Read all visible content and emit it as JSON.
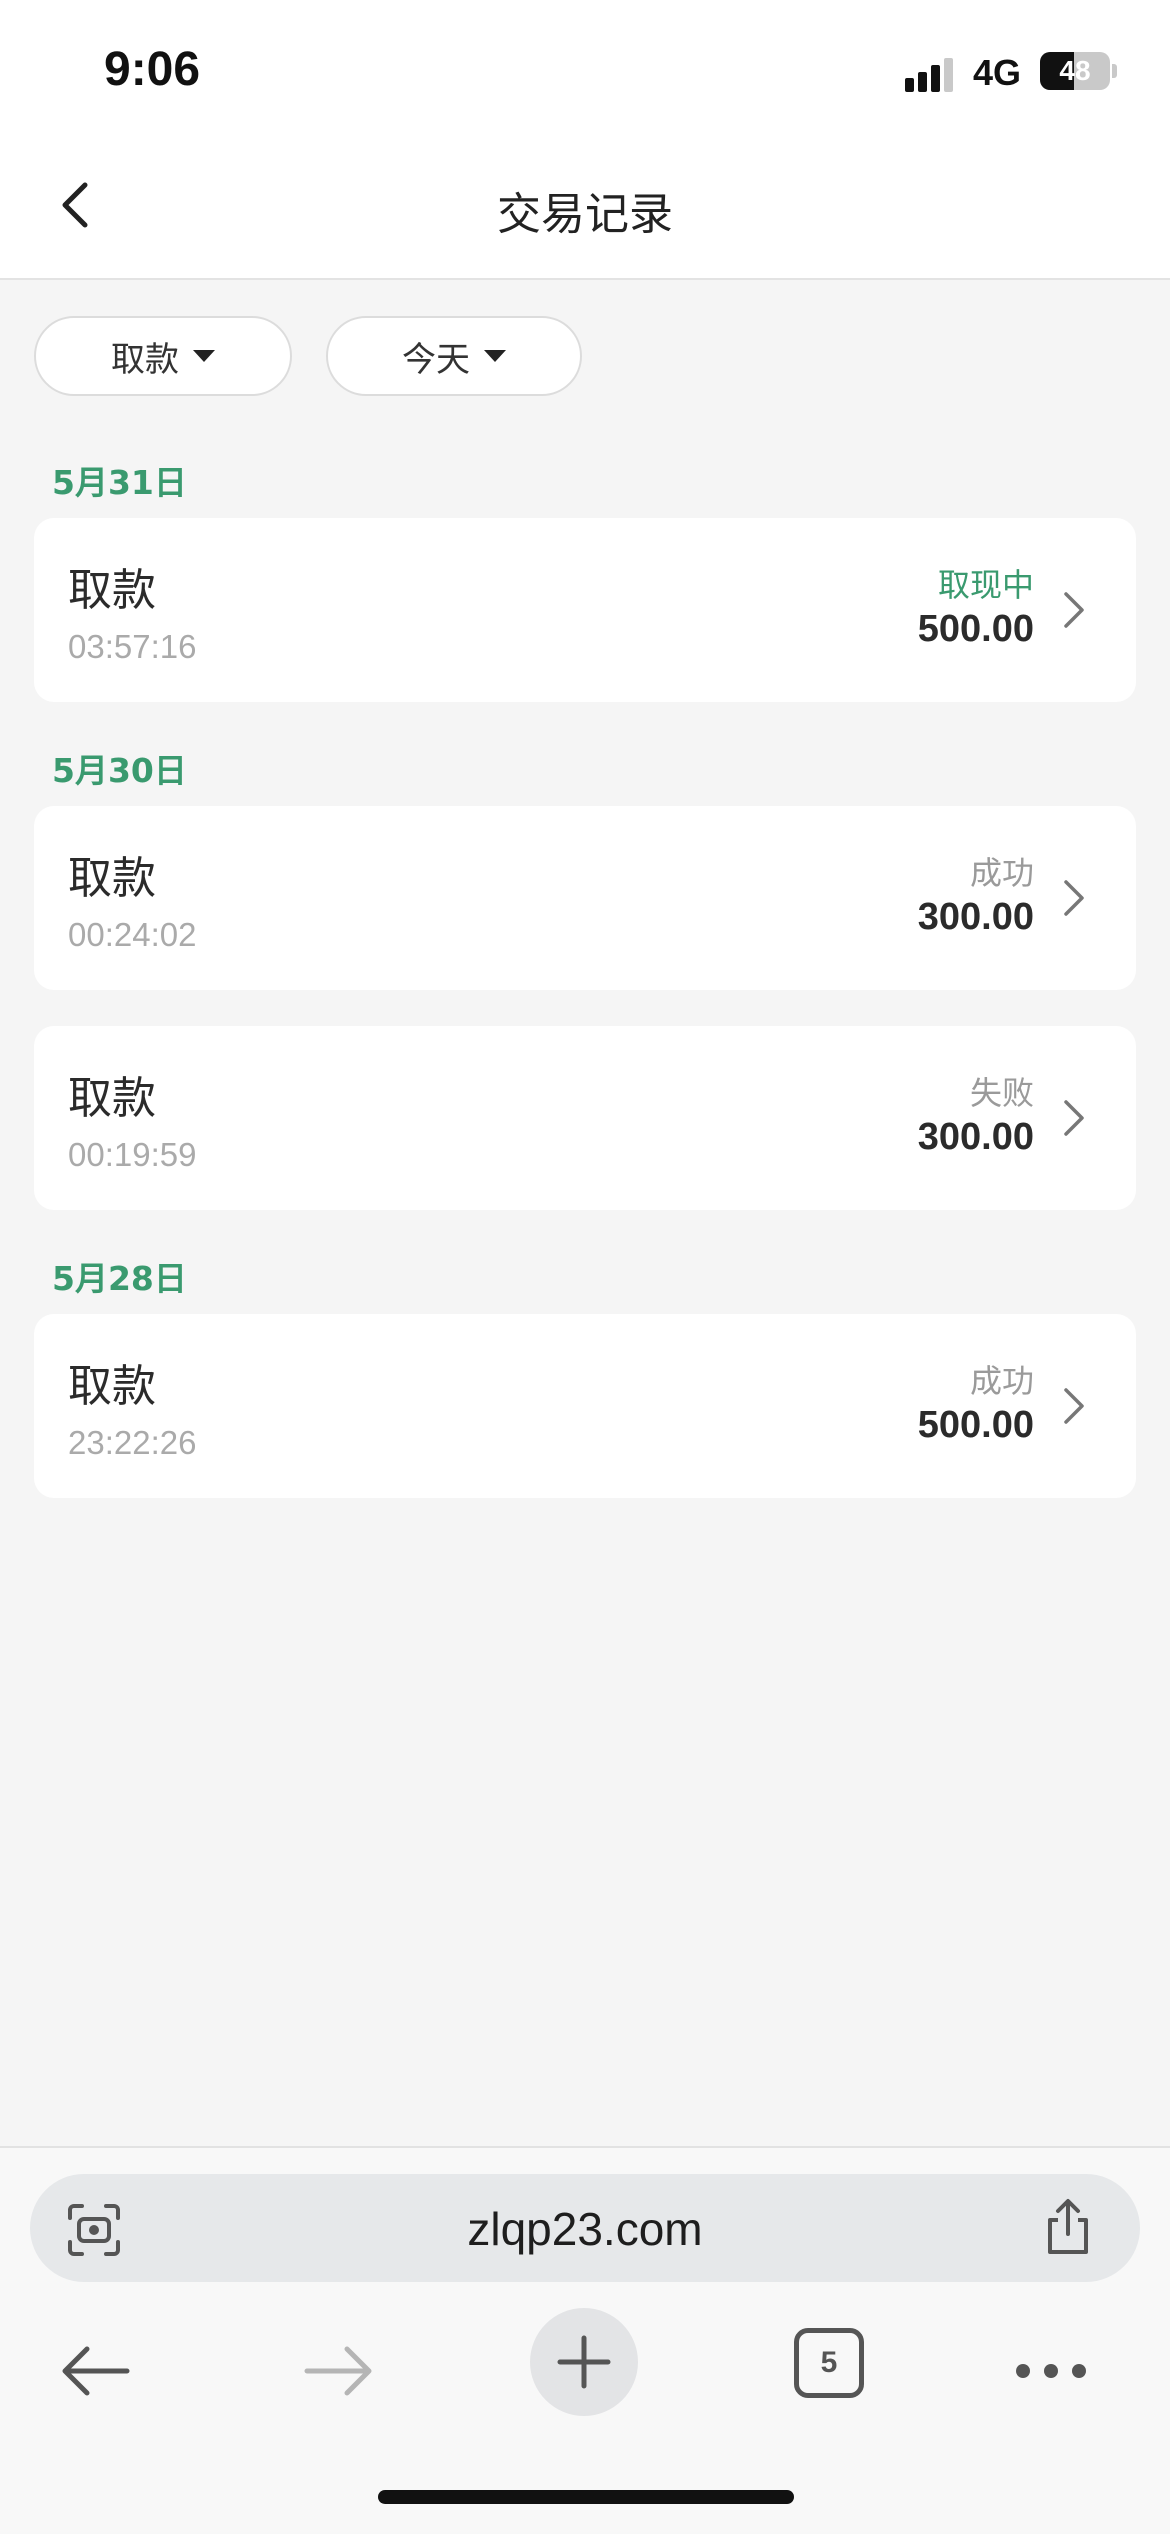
{
  "status_bar": {
    "time": "9:06",
    "network": "4G",
    "battery": "48",
    "battery_level": 0.48
  },
  "header": {
    "title": "交易记录",
    "back_icon": "chevron-left-icon"
  },
  "filters": [
    {
      "label": "取款"
    },
    {
      "label": "今天"
    }
  ],
  "groups": [
    {
      "date": "5月31日",
      "records": [
        {
          "type": "取款",
          "time": "03:57:16",
          "status": "取现中",
          "amount": "500.00",
          "status_kind": "pending"
        }
      ]
    },
    {
      "date": "5月30日",
      "records": [
        {
          "type": "取款",
          "time": "00:24:02",
          "status": "成功",
          "amount": "300.00",
          "status_kind": "success"
        },
        {
          "type": "取款",
          "time": "00:19:59",
          "status": "失败",
          "amount": "300.00",
          "status_kind": "failed"
        }
      ]
    },
    {
      "date": "5月28日",
      "records": [
        {
          "type": "取款",
          "time": "23:22:26",
          "status": "成功",
          "amount": "500.00",
          "status_kind": "success"
        }
      ]
    }
  ],
  "browser": {
    "url": "zlqp23.com",
    "tab_count": "5"
  },
  "colors": {
    "accent": "#3a9a6f",
    "background": "#f5f5f5",
    "card": "#ffffff"
  }
}
